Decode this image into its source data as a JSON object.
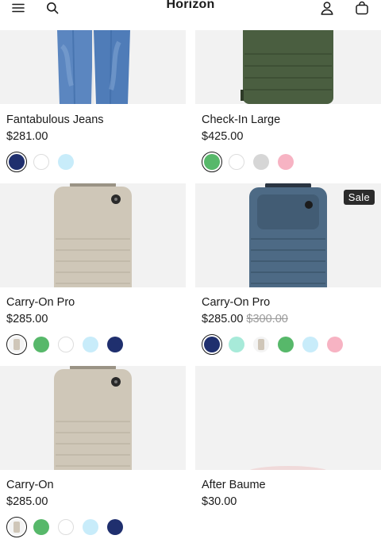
{
  "header": {
    "brand": "Horizon",
    "icons": [
      "menu-icon",
      "search-icon",
      "account-icon",
      "cart-icon"
    ]
  },
  "products": [
    {
      "title": "Fantabulous Jeans",
      "price": "$281.00",
      "compare_price": "",
      "sale_badge": "",
      "image": "jeans",
      "swatches": [
        {
          "color": "#1f2f6e",
          "selected": true
        },
        {
          "color": "#ffffff",
          "selected": false
        },
        {
          "color": "#c8ecfa",
          "selected": false
        }
      ]
    },
    {
      "title": "Check-In Large",
      "price": "$425.00",
      "compare_price": "",
      "sale_badge": "",
      "image": "suitcase-green",
      "swatches": [
        {
          "color": "#57b86a",
          "selected": true
        },
        {
          "color": "#ffffff",
          "selected": false
        },
        {
          "color": "#d6d6d6",
          "selected": false
        },
        {
          "color": "#f7b3c3",
          "selected": false
        }
      ]
    },
    {
      "title": "Carry-On Pro",
      "price": "$285.00",
      "compare_price": "",
      "sale_badge": "",
      "image": "suitcase-beige",
      "swatches": [
        {
          "color": "#cfc6b8",
          "selected": true,
          "thumb": true
        },
        {
          "color": "#57b86a",
          "selected": false
        },
        {
          "color": "#ffffff",
          "selected": false
        },
        {
          "color": "#c8ecfa",
          "selected": false
        },
        {
          "color": "#1f2f6e",
          "selected": false
        }
      ]
    },
    {
      "title": "Carry-On Pro",
      "price": "$285.00",
      "compare_price": "$300.00",
      "sale_badge": "Sale",
      "image": "suitcase-blue",
      "swatches": [
        {
          "color": "#1f2f6e",
          "selected": true
        },
        {
          "color": "#a7ead9",
          "selected": false
        },
        {
          "color": "#cfc6b8",
          "selected": false,
          "thumb": true
        },
        {
          "color": "#57b86a",
          "selected": false
        },
        {
          "color": "#c8ecfa",
          "selected": false
        },
        {
          "color": "#f7b3c3",
          "selected": false
        }
      ]
    },
    {
      "title": "Carry-On",
      "price": "$285.00",
      "compare_price": "",
      "sale_badge": "",
      "image": "suitcase-beige",
      "swatches": [
        {
          "color": "#cfc6b8",
          "selected": true,
          "thumb": true
        },
        {
          "color": "#57b86a",
          "selected": false
        },
        {
          "color": "#ffffff",
          "selected": false
        },
        {
          "color": "#c8ecfa",
          "selected": false
        },
        {
          "color": "#1f2f6e",
          "selected": false
        }
      ]
    },
    {
      "title": "After Baume",
      "price": "$30.00",
      "compare_price": "",
      "sale_badge": "",
      "image": "blank",
      "swatches": []
    }
  ]
}
